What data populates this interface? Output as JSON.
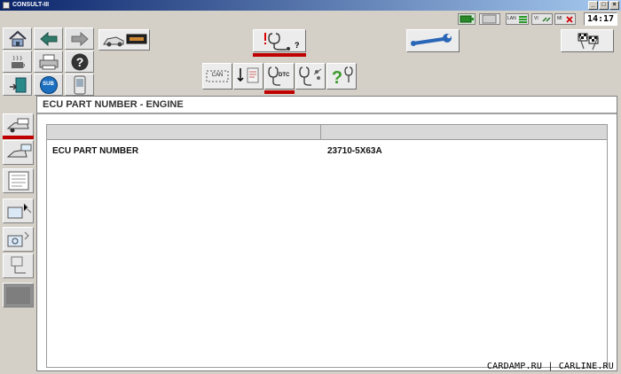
{
  "window": {
    "title": "CONSULT-III",
    "controls": [
      "_",
      "□",
      "×"
    ]
  },
  "status": {
    "indicators": [
      "LAN",
      "VI",
      "MI"
    ],
    "clock": "14:17"
  },
  "toolbar": {
    "icons": [
      "home-icon",
      "back-icon",
      "forward-icon",
      "car-display-icon",
      "printer-icon",
      "help-icon",
      "sub-icon",
      "phone-icon",
      "diagnosis-icon",
      "wrench-icon",
      "flag-icon",
      "can-icon",
      "dtc-icon",
      "question-icon"
    ],
    "can_label": "CAN",
    "dtc_label": "DTC",
    "sub_label": "SUB",
    "active_color": "#c00000"
  },
  "main": {
    "heading": "ECU PART NUMBER - ENGINE",
    "table": {
      "rows": [
        {
          "label": "ECU PART NUMBER",
          "value": "23710-5X63A"
        }
      ]
    }
  },
  "footer": {
    "watermark": "CARDAMP.RU | CARLINE.RU"
  }
}
